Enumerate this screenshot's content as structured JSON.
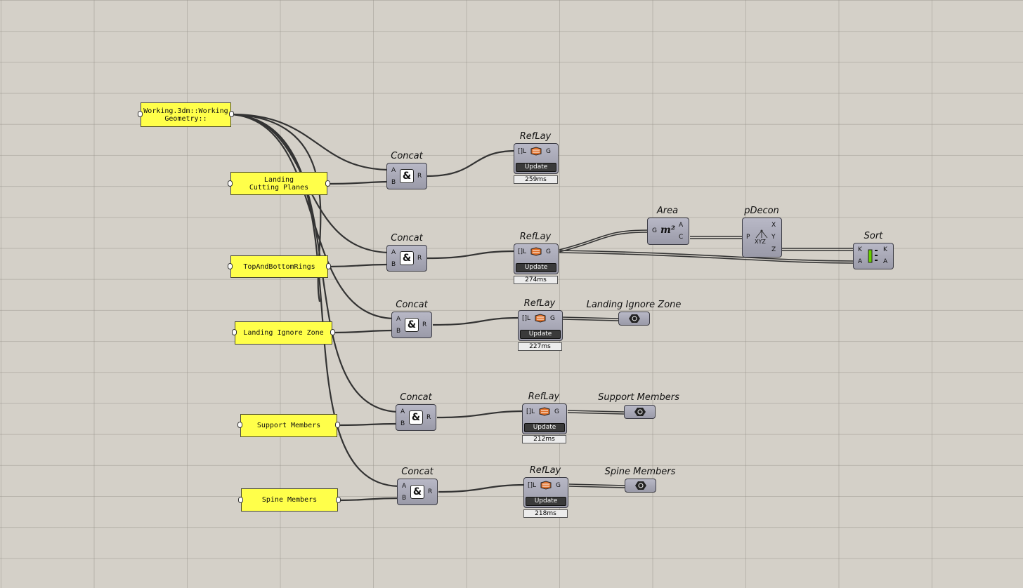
{
  "panels": {
    "working": "Working.3dm::Working Geometry::",
    "landing_planes": "Landing Cutting Planes",
    "rings": "TopAndBottomRings",
    "ignore_zone": "Landing Ignore Zone",
    "support": "Support Members",
    "spine": "Spine Members"
  },
  "concat": {
    "title": "Concat",
    "in_a": "A",
    "in_b": "B",
    "out_r": "R",
    "icon": "&"
  },
  "reflay": {
    "title": "RefLay",
    "in_l": "[]L",
    "out_g": "G",
    "update_label": "Update",
    "timings": [
      "259ms",
      "274ms",
      "227ms",
      "212ms",
      "218ms"
    ]
  },
  "area": {
    "title": "Area",
    "in_g": "G",
    "out_a": "A",
    "out_c": "C",
    "icon": "m²"
  },
  "pdecon": {
    "title": "pDecon",
    "in_p": "P",
    "out_x": "X",
    "out_y": "Y",
    "out_z": "Z",
    "icon_text": "XYZ"
  },
  "sort": {
    "title": "Sort",
    "in_k": "K",
    "in_a": "A",
    "out_k": "K",
    "out_a": "A"
  },
  "params": {
    "ignore_zone": "Landing Ignore Zone",
    "support": "Support Members",
    "spine": "Spine Members"
  },
  "icons": {
    "concat": "ampersand-icon",
    "reflay": "layer-icon",
    "area": "area-icon",
    "pdecon": "deconstruct-point-icon",
    "sort": "sort-icon",
    "param": "geometry-param-icon"
  },
  "colors": {
    "canvas": "#d4d0c8",
    "panel": "#ffff4a",
    "component": "#a8a8b6",
    "wire": "#3a3a3a"
  }
}
